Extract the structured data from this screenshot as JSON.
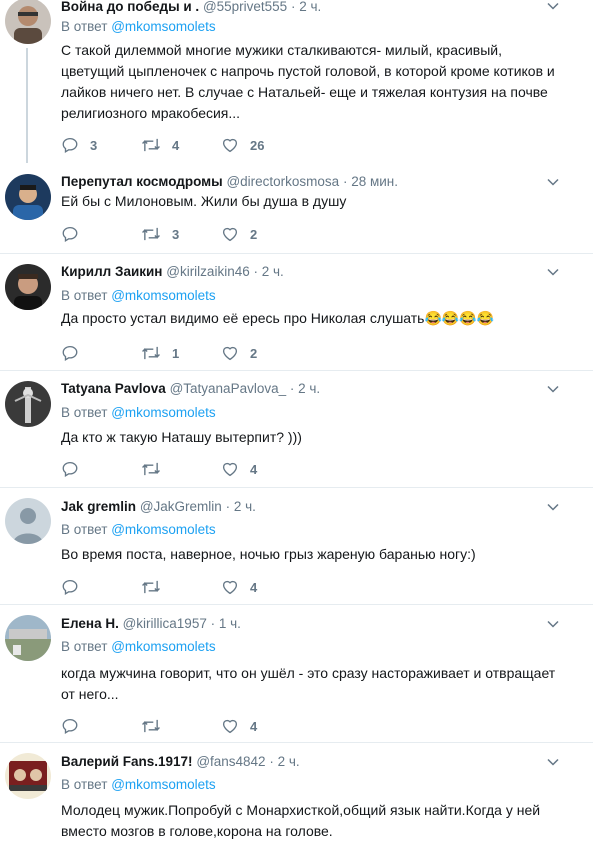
{
  "reply_prefix": "В ответ",
  "tweets": [
    {
      "name": "Война до победы и .",
      "handle": "@55privet555",
      "dot": "·",
      "time": "2 ч.",
      "reply_to": "@mkomsomolets",
      "text": "С такой дилеммой многие мужики сталкиваются- милый, красивый, цветущий цыпленочек с напрочь пустой головой, в которой кроме котиков и лайков ничего нет. В случае с Натальей- еще и тяжелая контузия на почве религиозного мракобесия...",
      "replies": "3",
      "retweets": "4",
      "likes": "26"
    },
    {
      "name": "Перепутал космодромы",
      "handle": "@directorkosmosa",
      "dot": "·",
      "time": "28 мин.",
      "reply_to": "",
      "text": "Ей бы с Милоновым. Жили бы душа в душу",
      "replies": "",
      "retweets": "3",
      "likes": "2"
    },
    {
      "name": "Кирилл Заикин",
      "handle": "@kirilzaikin46",
      "dot": "·",
      "time": "2 ч.",
      "reply_to": "@mkomsomolets",
      "text": "Да просто устал видимо её ересь про Николая слушать",
      "emoji": "😂😂😂😂",
      "replies": "",
      "retweets": "1",
      "likes": "2"
    },
    {
      "name": "Tatyana Pavlova",
      "handle": "@TatyanaPavlova_",
      "dot": "·",
      "time": "2 ч.",
      "reply_to": "@mkomsomolets",
      "text": "Да кто ж такую Наташу вытерпит? )))",
      "replies": "",
      "retweets": "",
      "likes": "4"
    },
    {
      "name": "Jak gremlin",
      "handle": "@JakGremlin",
      "dot": "·",
      "time": "2 ч.",
      "reply_to": "@mkomsomolets",
      "text": "Во время поста, наверное, ночью грыз жареную баранью ногу:)",
      "replies": "",
      "retweets": "",
      "likes": "4"
    },
    {
      "name": "Елена Н.",
      "handle": "@kirillica1957",
      "dot": "·",
      "time": "1 ч.",
      "reply_to": "@mkomsomolets",
      "text": "когда мужчина говорит, что он ушёл - это сразу настораживает и отвращает от него...",
      "replies": "",
      "retweets": "",
      "likes": "4"
    },
    {
      "name": "Валерий Fans.1917!",
      "handle": "@fans4842",
      "dot": "·",
      "time": "2 ч.",
      "reply_to": "@mkomsomolets",
      "text": "Молодец мужик.Попробуй с Монархисткой,общий язык найти.Когда у ней вместо мозгов в голове,корона на голове.",
      "replies": "",
      "retweets": "",
      "likes": ""
    }
  ],
  "icons": {
    "reply": "reply-icon",
    "retweet": "retweet-icon",
    "like": "heart-icon",
    "more": "chevron-down-icon"
  },
  "colors": {
    "name": "#14171a",
    "secondary": "#657786",
    "mention": "#1da1f2",
    "divider": "#e6ecf0",
    "thread_line": "#ccd6dd"
  }
}
